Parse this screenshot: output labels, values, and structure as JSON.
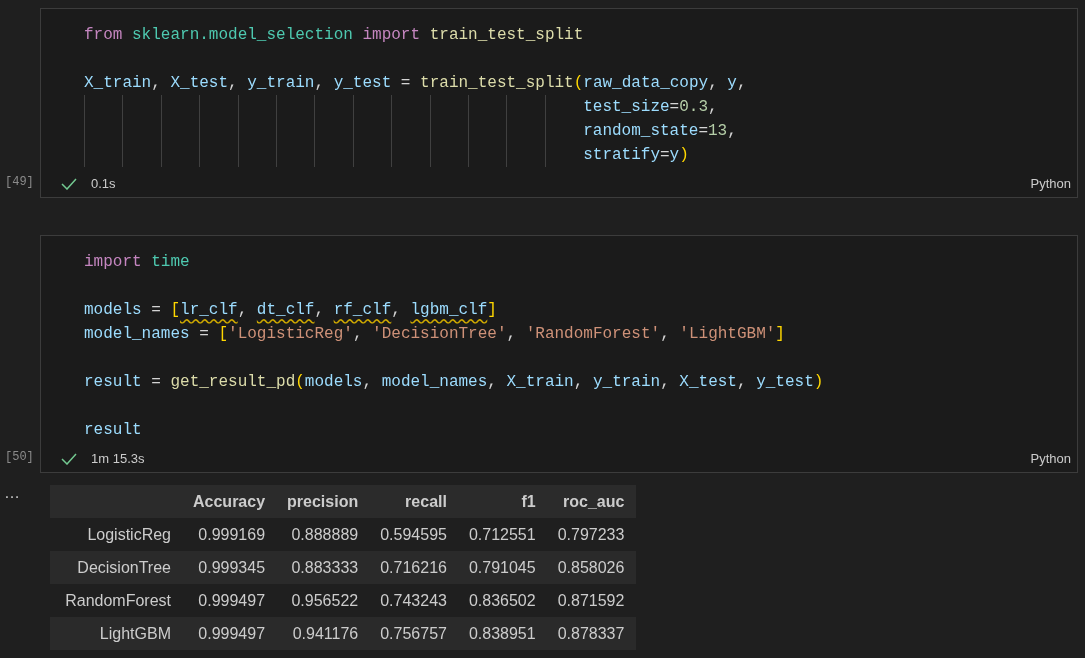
{
  "cells": [
    {
      "execution_count": "[49]",
      "succeeded": true,
      "duration": "0.1s",
      "language": "Python",
      "code": [
        {
          "kind": "code",
          "tokens": [
            {
              "t": "from ",
              "kind": "keyword"
            },
            {
              "t": "sklearn.model_selection ",
              "kind": "module"
            },
            {
              "t": "import ",
              "kind": "keyword"
            },
            {
              "t": "train_test_split",
              "kind": "function"
            }
          ]
        },
        {
          "kind": "blank"
        },
        {
          "kind": "code",
          "tokens": [
            {
              "t": "X_train",
              "kind": "variable"
            },
            {
              "t": ", ",
              "kind": "plain"
            },
            {
              "t": "X_test",
              "kind": "variable"
            },
            {
              "t": ", ",
              "kind": "plain"
            },
            {
              "t": "y_train",
              "kind": "variable"
            },
            {
              "t": ", ",
              "kind": "plain"
            },
            {
              "t": "y_test",
              "kind": "variable"
            },
            {
              "t": " = ",
              "kind": "plain"
            },
            {
              "t": "train_test_split",
              "kind": "function"
            },
            {
              "t": "(",
              "kind": "bracket"
            },
            {
              "t": "raw_data_copy",
              "kind": "variable"
            },
            {
              "t": ", ",
              "kind": "plain"
            },
            {
              "t": "y",
              "kind": "variable"
            },
            {
              "t": ",",
              "kind": "plain"
            }
          ]
        },
        {
          "kind": "continuation",
          "tokens": [
            {
              "t": "test_size",
              "kind": "variable"
            },
            {
              "t": "=",
              "kind": "plain"
            },
            {
              "t": "0.3",
              "kind": "number"
            },
            {
              "t": ",",
              "kind": "plain"
            }
          ]
        },
        {
          "kind": "continuation",
          "tokens": [
            {
              "t": "random_state",
              "kind": "variable"
            },
            {
              "t": "=",
              "kind": "plain"
            },
            {
              "t": "13",
              "kind": "number"
            },
            {
              "t": ",",
              "kind": "plain"
            }
          ]
        },
        {
          "kind": "continuation",
          "tokens": [
            {
              "t": "stratify",
              "kind": "variable"
            },
            {
              "t": "=",
              "kind": "plain"
            },
            {
              "t": "y",
              "kind": "variable"
            },
            {
              "t": ")",
              "kind": "bracket"
            }
          ]
        }
      ]
    },
    {
      "execution_count": "[50]",
      "succeeded": true,
      "duration": "1m 15.3s",
      "language": "Python",
      "code": [
        {
          "kind": "code",
          "tokens": [
            {
              "t": "import ",
              "kind": "keyword"
            },
            {
              "t": "time",
              "kind": "module"
            }
          ]
        },
        {
          "kind": "blank"
        },
        {
          "kind": "code",
          "tokens": [
            {
              "t": "models",
              "kind": "variable"
            },
            {
              "t": " = ",
              "kind": "plain"
            },
            {
              "t": "[",
              "kind": "bracket"
            },
            {
              "t": "lr_clf",
              "kind": "variable",
              "warning": true
            },
            {
              "t": ", ",
              "kind": "plain"
            },
            {
              "t": "dt_clf",
              "kind": "variable",
              "warning": true
            },
            {
              "t": ", ",
              "kind": "plain"
            },
            {
              "t": "rf_clf",
              "kind": "variable",
              "warning": true
            },
            {
              "t": ", ",
              "kind": "plain"
            },
            {
              "t": "lgbm_clf",
              "kind": "variable",
              "warning": true
            },
            {
              "t": "]",
              "kind": "bracket"
            }
          ]
        },
        {
          "kind": "code",
          "tokens": [
            {
              "t": "model_names",
              "kind": "variable"
            },
            {
              "t": " = ",
              "kind": "plain"
            },
            {
              "t": "[",
              "kind": "bracket"
            },
            {
              "t": "'LogisticReg'",
              "kind": "string"
            },
            {
              "t": ", ",
              "kind": "plain"
            },
            {
              "t": "'DecisionTree'",
              "kind": "string"
            },
            {
              "t": ", ",
              "kind": "plain"
            },
            {
              "t": "'RandomForest'",
              "kind": "string"
            },
            {
              "t": ", ",
              "kind": "plain"
            },
            {
              "t": "'LightGBM'",
              "kind": "string"
            },
            {
              "t": "]",
              "kind": "bracket"
            }
          ]
        },
        {
          "kind": "blank"
        },
        {
          "kind": "code",
          "tokens": [
            {
              "t": "result",
              "kind": "variable"
            },
            {
              "t": " = ",
              "kind": "plain"
            },
            {
              "t": "get_result_pd",
              "kind": "function"
            },
            {
              "t": "(",
              "kind": "bracket"
            },
            {
              "t": "models",
              "kind": "variable"
            },
            {
              "t": ", ",
              "kind": "plain"
            },
            {
              "t": "model_names",
              "kind": "variable"
            },
            {
              "t": ", ",
              "kind": "plain"
            },
            {
              "t": "X_train",
              "kind": "variable"
            },
            {
              "t": ", ",
              "kind": "plain"
            },
            {
              "t": "y_train",
              "kind": "variable"
            },
            {
              "t": ", ",
              "kind": "plain"
            },
            {
              "t": "X_test",
              "kind": "variable"
            },
            {
              "t": ", ",
              "kind": "plain"
            },
            {
              "t": "y_test",
              "kind": "variable"
            },
            {
              "t": ")",
              "kind": "bracket"
            }
          ]
        },
        {
          "kind": "blank"
        },
        {
          "kind": "code",
          "tokens": [
            {
              "t": "result",
              "kind": "variable"
            }
          ]
        }
      ]
    }
  ],
  "output": {
    "menu": "…",
    "table": {
      "columns": [
        null,
        "Accuracy",
        "precision",
        "recall",
        "f1",
        "roc_auc"
      ],
      "rows": [
        [
          "LogisticReg",
          "0.999169",
          "0.888889",
          "0.594595",
          "0.712551",
          "0.797233"
        ],
        [
          "DecisionTree",
          "0.999345",
          "0.883333",
          "0.716216",
          "0.791045",
          "0.858026"
        ],
        [
          "RandomForest",
          "0.999497",
          "0.956522",
          "0.743243",
          "0.836502",
          "0.871592"
        ],
        [
          "LightGBM",
          "0.999497",
          "0.941176",
          "0.756757",
          "0.838951",
          "0.878337"
        ]
      ]
    }
  }
}
